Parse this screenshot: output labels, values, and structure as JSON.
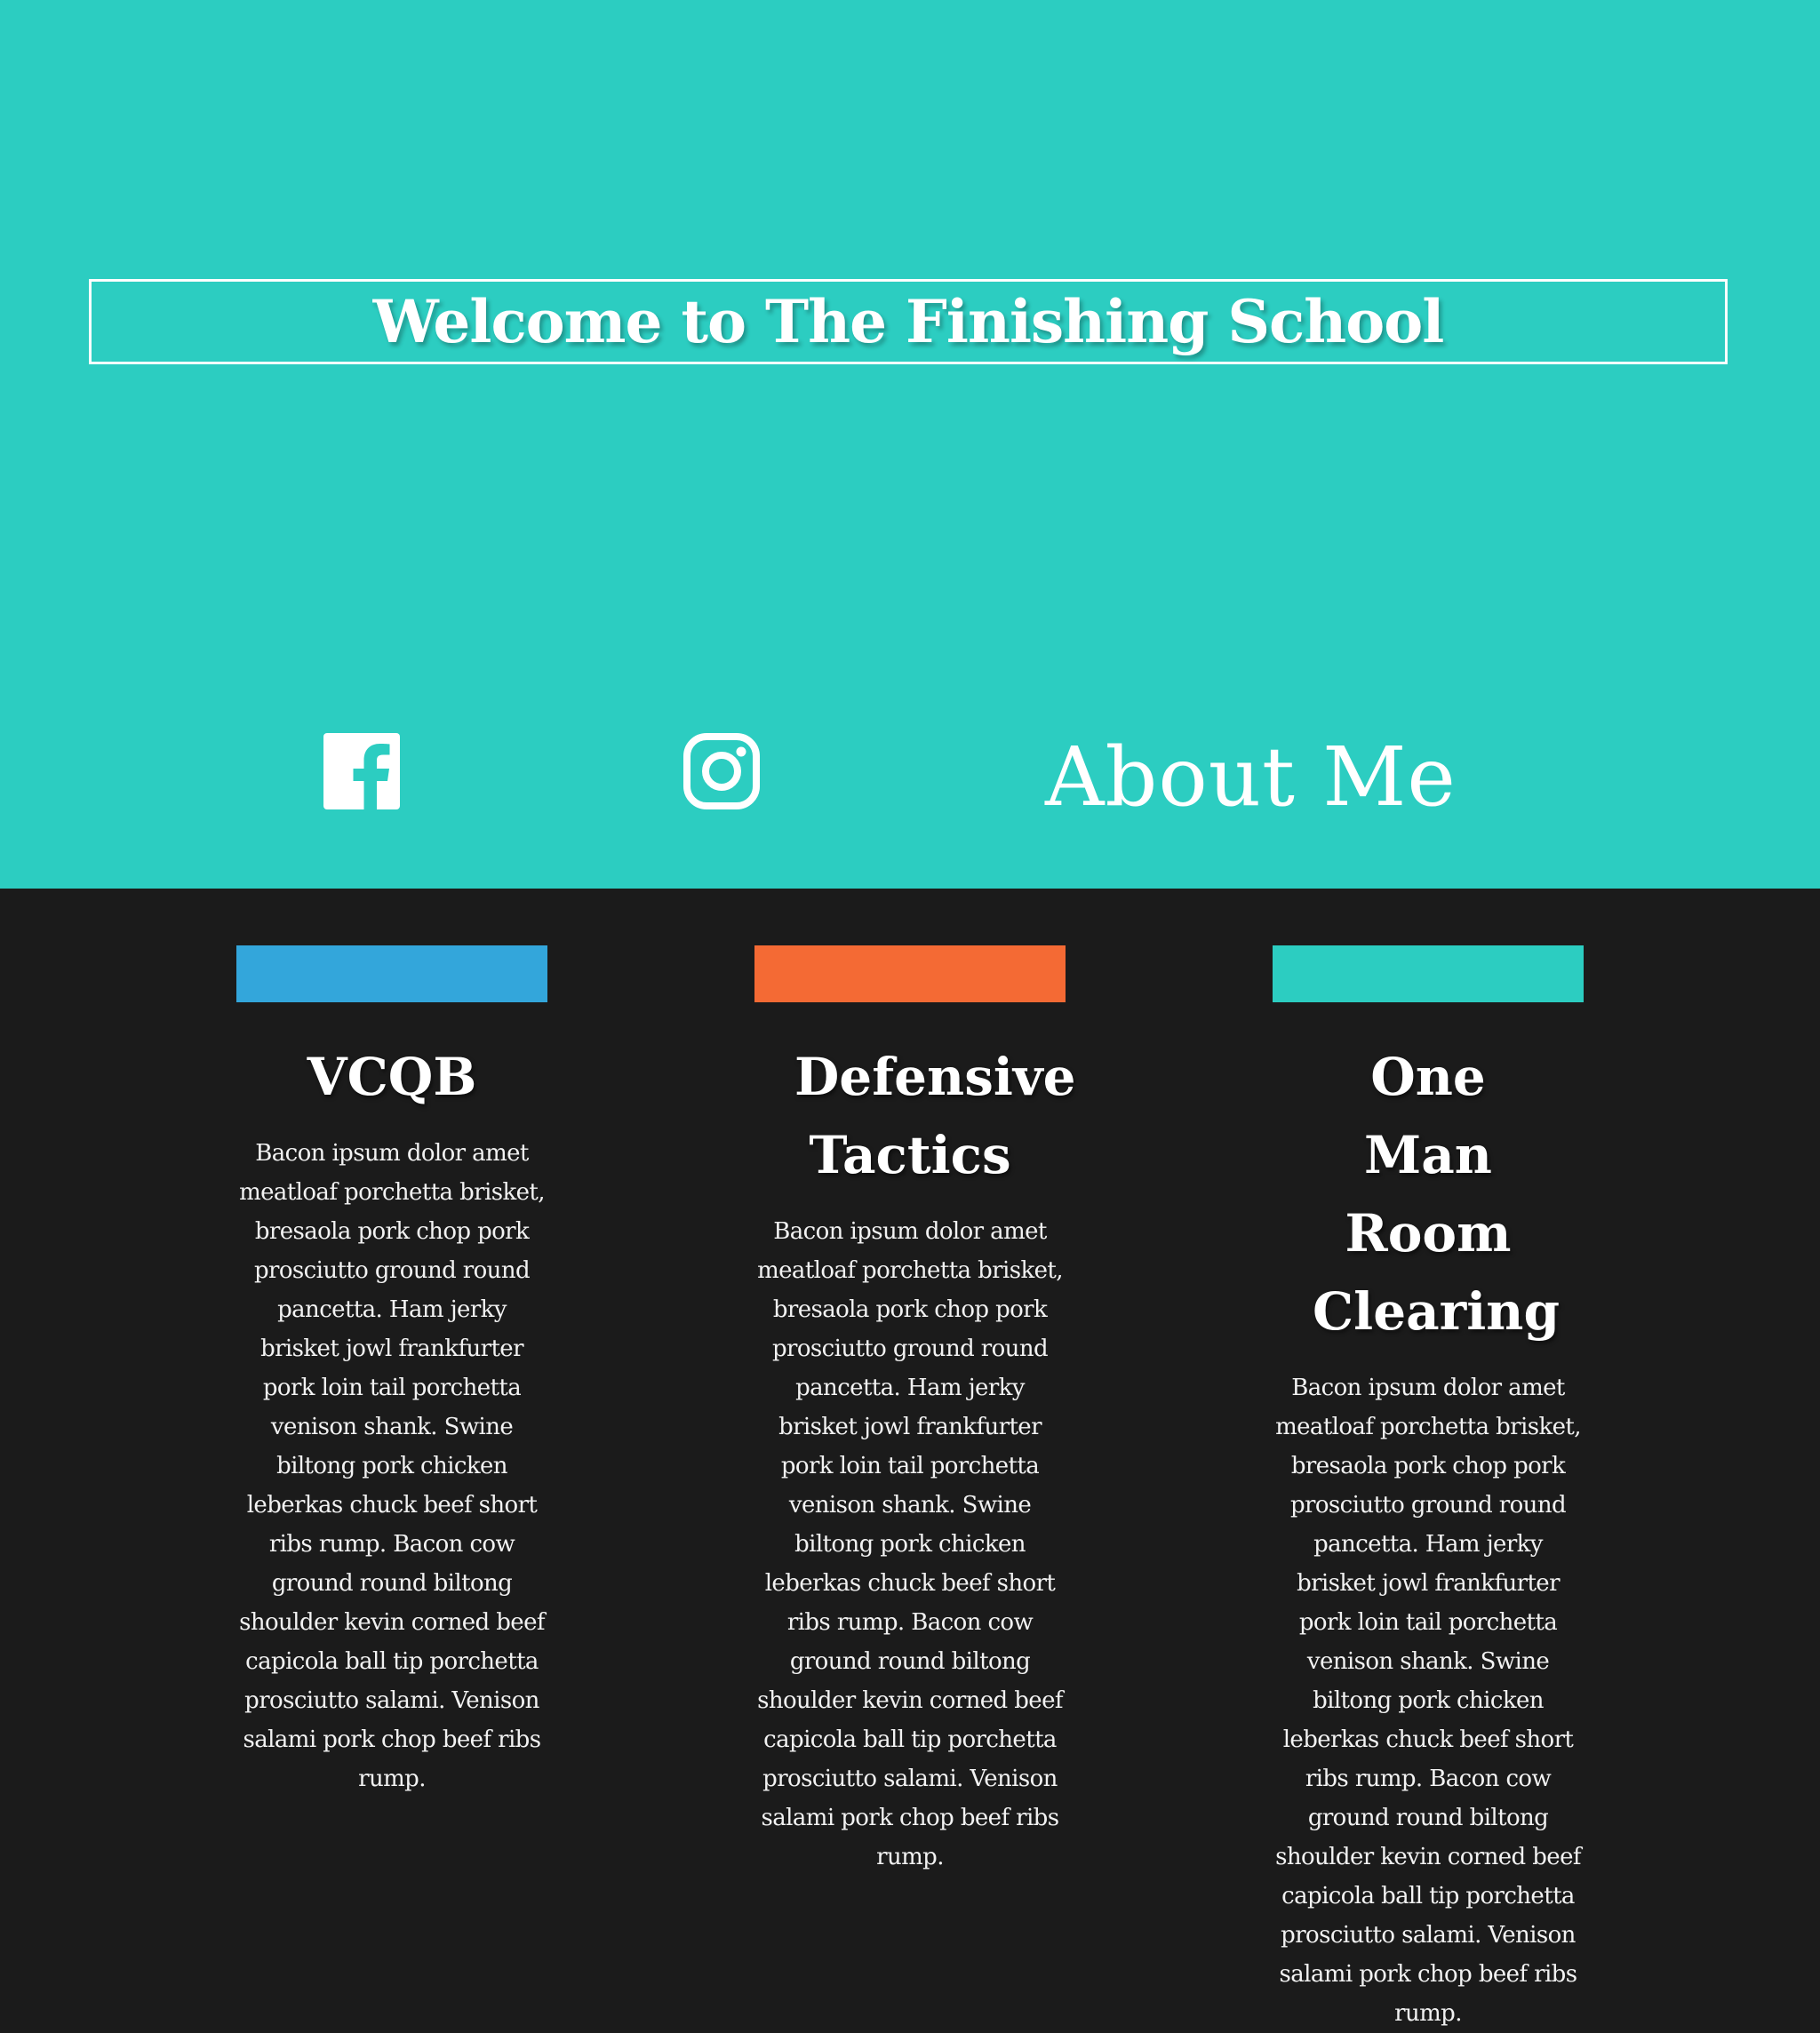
{
  "colors": {
    "hero_background": "#2ccdc1",
    "page_background": "#1b1b1b",
    "text": "#ffffff",
    "bar_blue": "#33a6db",
    "bar_orange": "#f46a34",
    "bar_teal": "#2ccdc1"
  },
  "hero": {
    "title": "Welcome to The Finishing School",
    "about_link": "About Me",
    "icons": [
      "facebook-icon",
      "instagram-icon"
    ]
  },
  "cards": [
    {
      "title": "VCQB",
      "text": "Bacon ipsum dolor amet meatloaf porchetta brisket, bresaola pork chop pork prosciutto ground round pancetta. Ham jerky brisket jowl frankfurter pork loin tail porchetta venison shank. Swine biltong pork chicken leberkas chuck beef short ribs rump. Bacon cow ground round biltong shoulder kevin corned beef capicola ball tip porchetta prosciutto salami. Venison salami pork chop beef ribs rump."
    },
    {
      "title": "Defensive Tactics",
      "text": "Bacon ipsum dolor amet meatloaf porchetta brisket, bresaola pork chop pork prosciutto ground round pancetta. Ham jerky brisket jowl frankfurter pork loin tail porchetta venison shank. Swine biltong pork chicken leberkas chuck beef short ribs rump. Bacon cow ground round biltong shoulder kevin corned beef capicola ball tip porchetta prosciutto salami. Venison salami pork chop beef ribs rump."
    },
    {
      "title": "One Man Room Clearing",
      "text": "Bacon ipsum dolor amet meatloaf porchetta brisket, bresaola pork chop pork prosciutto ground round pancetta. Ham jerky brisket jowl frankfurter pork loin tail porchetta venison shank. Swine biltong pork chicken leberkas chuck beef short ribs rump. Bacon cow ground round biltong shoulder kevin corned beef capicola ball tip porchetta prosciutto salami. Venison salami pork chop beef ribs rump."
    }
  ]
}
